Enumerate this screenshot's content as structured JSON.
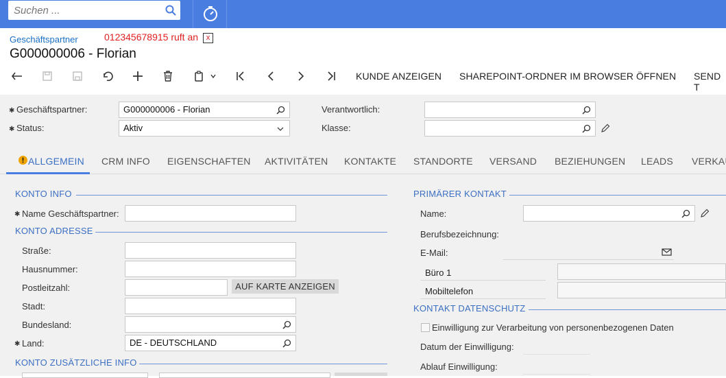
{
  "search": {
    "placeholder": "Suchen ..."
  },
  "header": {
    "breadcrumb": "Geschäftspartner",
    "call_notice": "012345678915 ruft an",
    "call_close": "x",
    "title": "G000000006 - Florian"
  },
  "toolbar": {
    "kunde_anzeigen": "KUNDE ANZEIGEN",
    "sharepoint": "SHAREPOINT-ORDNER IM BROWSER ÖFFNEN",
    "send": "SEND T"
  },
  "summary": {
    "partner_label": "Geschäftspartner:",
    "partner_value": "G000000006 - Florian",
    "status_label": "Status:",
    "status_value": "Aktiv",
    "verantwortlich_label": "Verantwortlich:",
    "klasse_label": "Klasse:"
  },
  "tabs": [
    "ALLGEMEIN",
    "CRM INFO",
    "EIGENSCHAFTEN",
    "AKTIVITÄTEN",
    "KONTAKTE",
    "STANDORTE",
    "VERSAND",
    "BEZIEHUNGEN",
    "LEADS",
    "VERKAU"
  ],
  "konto_info": {
    "title": "KONTO INFO",
    "name_label": "Name Geschäftspartner:"
  },
  "konto_adresse": {
    "title": "KONTO ADRESSE",
    "strasse": "Straße:",
    "hausnummer": "Hausnummer:",
    "plz": "Postleitzahl:",
    "karte_button": "AUF KARTE ANZEIGEN",
    "stadt": "Stadt:",
    "bundesland": "Bundesland:",
    "land_label": "Land:",
    "land_value": "DE - DEUTSCHLAND"
  },
  "konto_zusatz": {
    "title": "KONTO ZUSÄTZLICHE INFO"
  },
  "primaer_kontakt": {
    "title": "PRIMÄRER KONTAKT",
    "name": "Name:",
    "beruf": "Berufsbezeichnung:",
    "email": "E-Mail:",
    "buero": "Büro 1",
    "mobil": "Mobiltelefon"
  },
  "datenschutz": {
    "title": "KONTAKT DATENSCHUTZ",
    "consent": "Einwilligung zur Verarbeitung von personenbezogenen Daten",
    "datum": "Datum der Einwilligung:",
    "ablauf": "Ablauf Einwilligung:"
  },
  "colors": {
    "accent": "#4a7de0",
    "link": "#1a6fc4",
    "section": "#3b6fc3",
    "alert": "#e02020",
    "warning": "#f0a400"
  }
}
